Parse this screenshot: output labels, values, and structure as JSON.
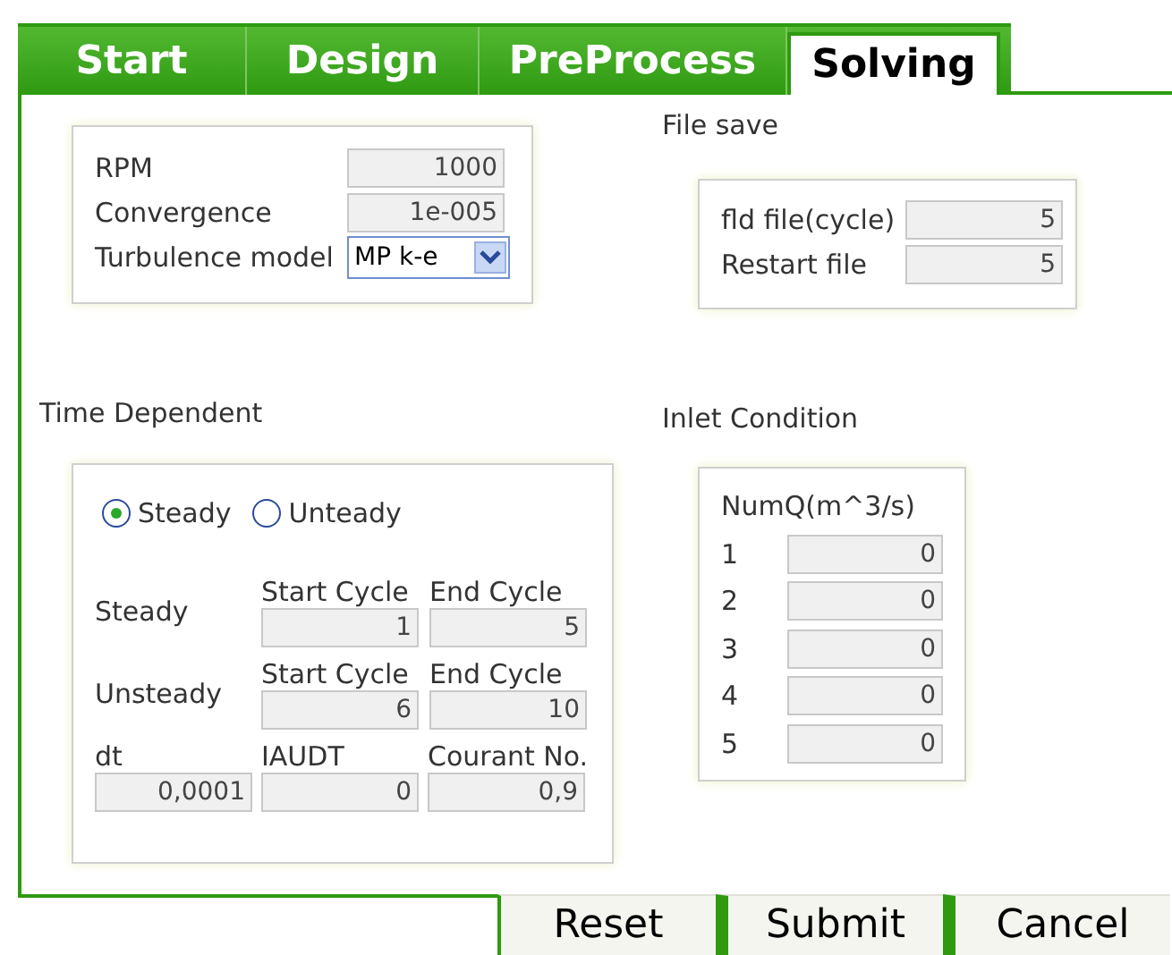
{
  "tabs": [
    {
      "label": "Start",
      "selected": false
    },
    {
      "label": "Design",
      "selected": false
    },
    {
      "label": "PreProcess",
      "selected": false
    },
    {
      "label": "Solving",
      "selected": true
    }
  ],
  "solver": {
    "fields": [
      {
        "label": "RPM",
        "value": "1000",
        "kind": "text"
      },
      {
        "label": "Convergence",
        "value": "1e-005",
        "kind": "text"
      },
      {
        "label": "Turbulence model",
        "value": "MP k-e",
        "kind": "select"
      }
    ]
  },
  "file_save": {
    "title": "File save",
    "fields": [
      {
        "label": "fld file(cycle)",
        "value": "5"
      },
      {
        "label": "Restart file",
        "value": "5"
      }
    ]
  },
  "time_dependent": {
    "title": "Time Dependent",
    "modes": [
      {
        "label": "Steady",
        "selected": true
      },
      {
        "label": "Unteady",
        "selected": false
      }
    ],
    "sections": [
      {
        "label": "Steady",
        "headers": [
          "Start Cycle",
          "End Cycle"
        ],
        "values": [
          "1",
          "5"
        ]
      },
      {
        "label": "Unsteady",
        "headers": [
          "Start Cycle",
          "End Cycle"
        ],
        "values": [
          "6",
          "10"
        ]
      }
    ],
    "params": [
      {
        "header": "dt",
        "value": "0,0001"
      },
      {
        "header": "IAUDT",
        "value": "0"
      },
      {
        "header": "Courant No.",
        "value": "0,9"
      }
    ]
  },
  "inlet": {
    "title": "Inlet Condition",
    "header": "NumQ(m^3/s)",
    "rows": [
      {
        "label": "1",
        "value": "0"
      },
      {
        "label": "2",
        "value": "0"
      },
      {
        "label": "3",
        "value": "0"
      },
      {
        "label": "4",
        "value": "0"
      },
      {
        "label": "5",
        "value": "0"
      }
    ]
  },
  "buttons": [
    "Reset",
    "Submit",
    "Cancel"
  ]
}
